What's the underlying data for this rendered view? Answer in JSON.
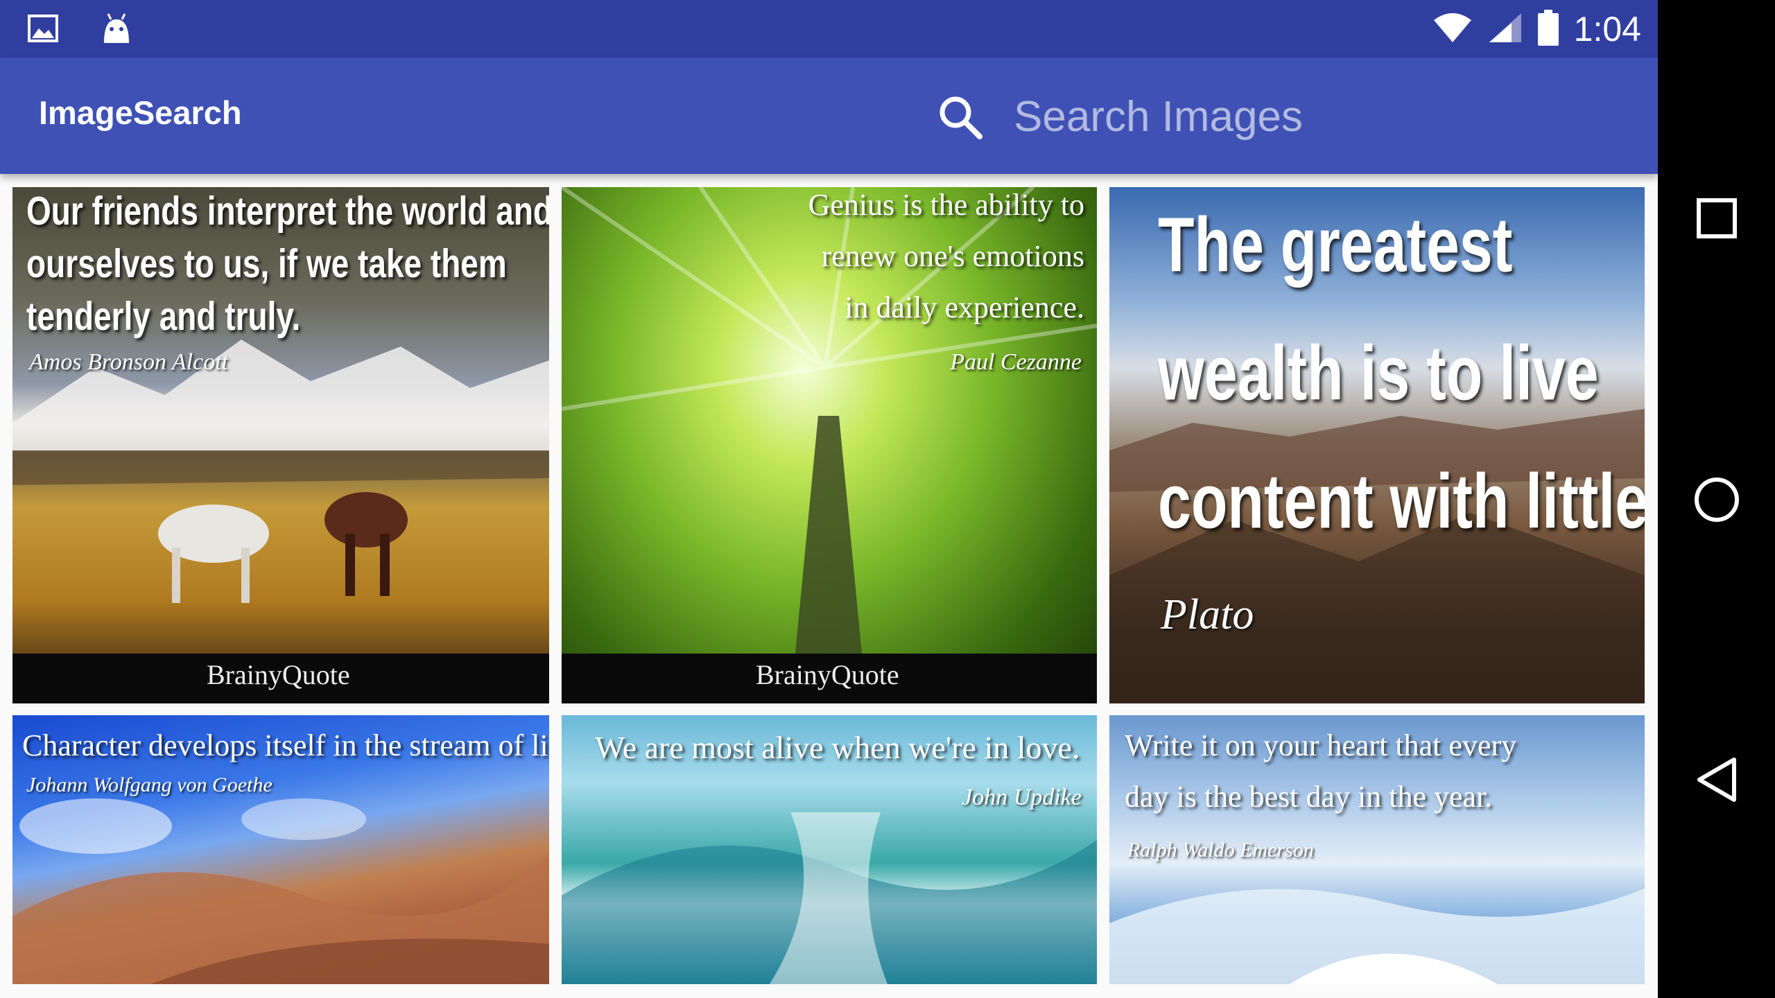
{
  "status_bar": {
    "time": "1:04",
    "left_icons": [
      "gallery-icon",
      "android-icon"
    ],
    "right_icons": [
      "wifi-icon",
      "signal-icon",
      "battery-icon"
    ]
  },
  "app_bar": {
    "title": "ImageSearch",
    "search": {
      "placeholder": "Search Images",
      "value": ""
    }
  },
  "results": [
    {
      "quote_lines": [
        "Our friends interpret the world and",
        "ourselves to us, if we take them",
        "tenderly and truly."
      ],
      "author": "Amos Bronson Alcott",
      "brand": "BrainyQuote"
    },
    {
      "quote_lines": [
        "Genius is the ability to",
        "renew one's emotions",
        "in daily experience."
      ],
      "author": "Paul Cezanne",
      "brand": "BrainyQuote"
    },
    {
      "quote_lines": [
        "The greatest",
        "wealth is to live",
        "content with little."
      ],
      "author": "Plato",
      "brand": ""
    },
    {
      "quote_lines": [
        "Character develops itself in the stream of life."
      ],
      "author": "Johann Wolfgang von Goethe",
      "brand": ""
    },
    {
      "quote_lines": [
        "We are most alive when we're in love."
      ],
      "author": "John Updike",
      "brand": ""
    },
    {
      "quote_lines": [
        "Write it on your heart that every",
        "day is the best day in the year."
      ],
      "author": "Ralph Waldo Emerson",
      "brand": ""
    }
  ],
  "nav_bar": {
    "buttons": [
      "recents-icon",
      "home-icon",
      "back-icon"
    ]
  },
  "colors": {
    "status_bar": "#303f9f",
    "app_bar": "#3f51b5",
    "background": "#fafafa"
  }
}
